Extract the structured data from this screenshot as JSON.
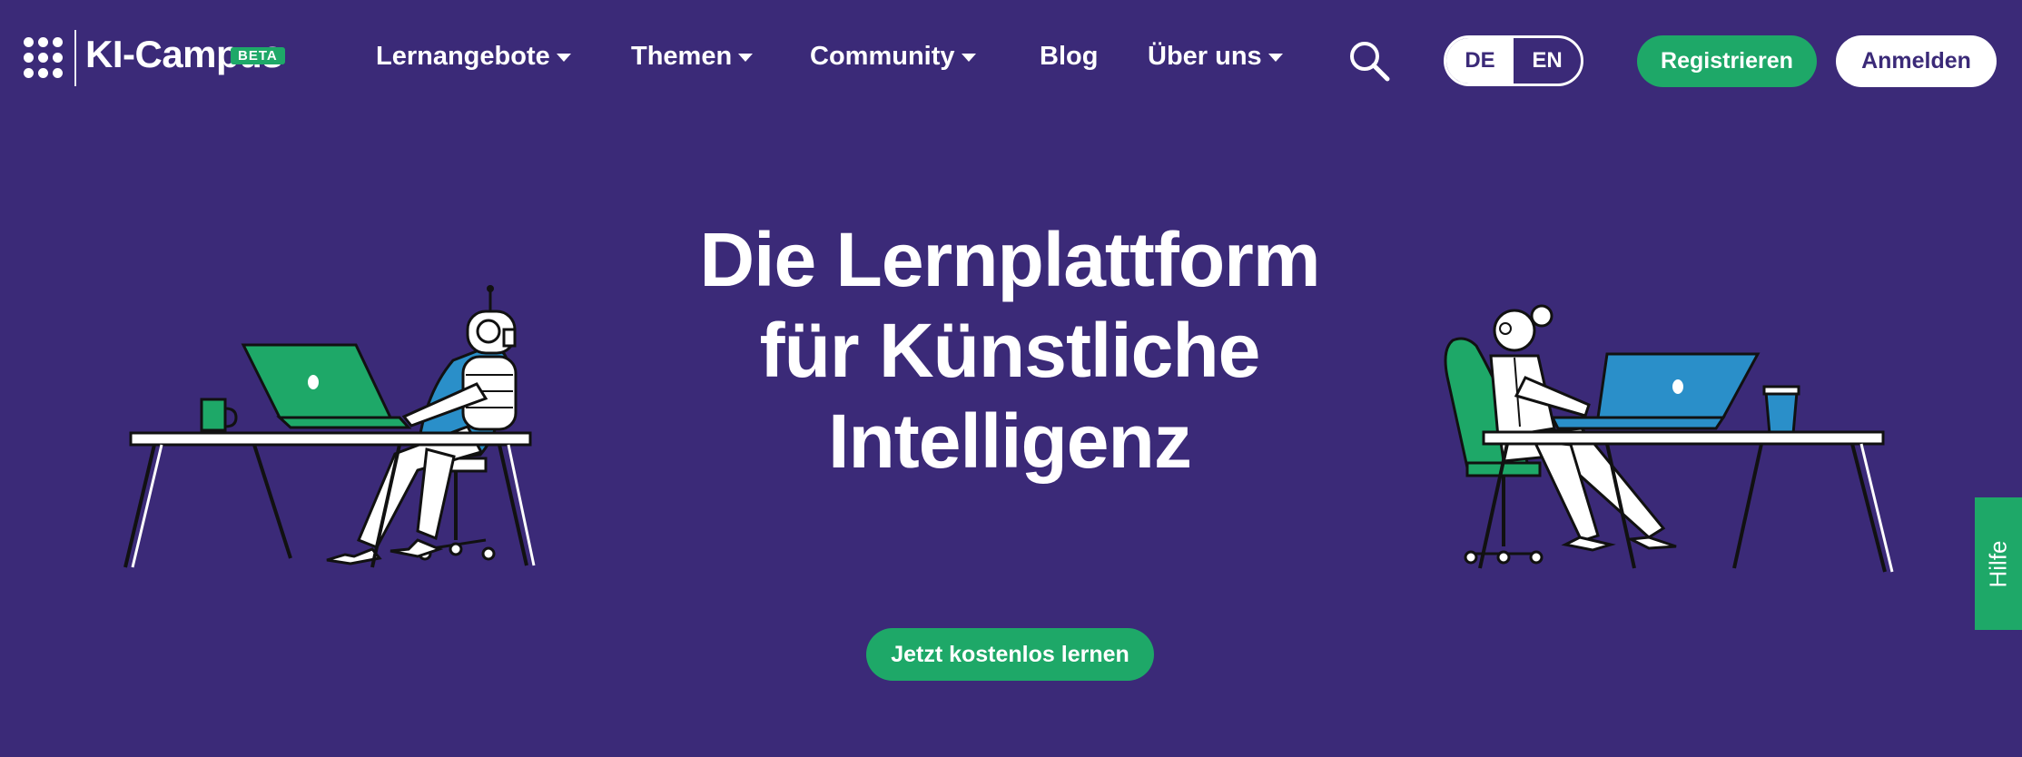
{
  "brand": {
    "name": "KI-Campus",
    "badge": "BETA"
  },
  "nav": {
    "items": [
      {
        "label": "Lernangebote",
        "dropdown": true
      },
      {
        "label": "Themen",
        "dropdown": true
      },
      {
        "label": "Community",
        "dropdown": true
      },
      {
        "label": "Blog",
        "dropdown": false
      },
      {
        "label": "Über uns",
        "dropdown": true
      }
    ]
  },
  "icons": {
    "search": "search-icon",
    "logo": "dot-grid-logo-icon",
    "dropdown": "caret-down-icon"
  },
  "language": {
    "options": [
      "DE",
      "EN"
    ],
    "selected": "DE"
  },
  "auth": {
    "register_label": "Registrieren",
    "login_label": "Anmelden"
  },
  "hero": {
    "title_lines": [
      "Die Lernplattform",
      "für Künstliche",
      "Intelligenz"
    ],
    "cta_label": "Jetzt kostenlos lernen"
  },
  "help": {
    "label": "Hilfe"
  },
  "colors": {
    "background": "#3b2a78",
    "accent_green": "#1ea868",
    "chair_blue": "#2a8fc9",
    "text": "#ffffff"
  }
}
